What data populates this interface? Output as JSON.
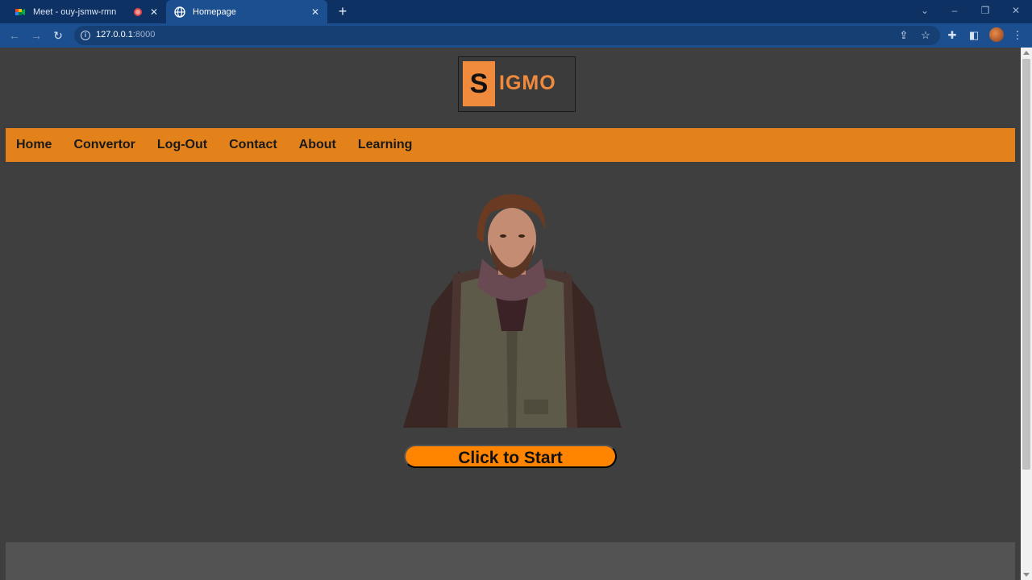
{
  "browser": {
    "tabs": [
      {
        "title": "Meet - ouy-jsmw-rmn",
        "icon": "google-meet-icon",
        "recording": true
      },
      {
        "title": "Homepage",
        "icon": "globe-icon",
        "active": true
      }
    ],
    "address": {
      "host": "127.0.0.1",
      "port": ":8000"
    }
  },
  "site": {
    "logo": {
      "initial": "S",
      "rest": "IGMO"
    },
    "nav": [
      "Home",
      "Convertor",
      "Log-Out",
      "Contact",
      "About",
      "Learning"
    ],
    "start_button": "Click to Start"
  },
  "colors": {
    "navbar": "#e3821a",
    "accent": "#ff8400",
    "logo_orange": "#f08a3c",
    "page_bg": "#3f3f3f"
  }
}
